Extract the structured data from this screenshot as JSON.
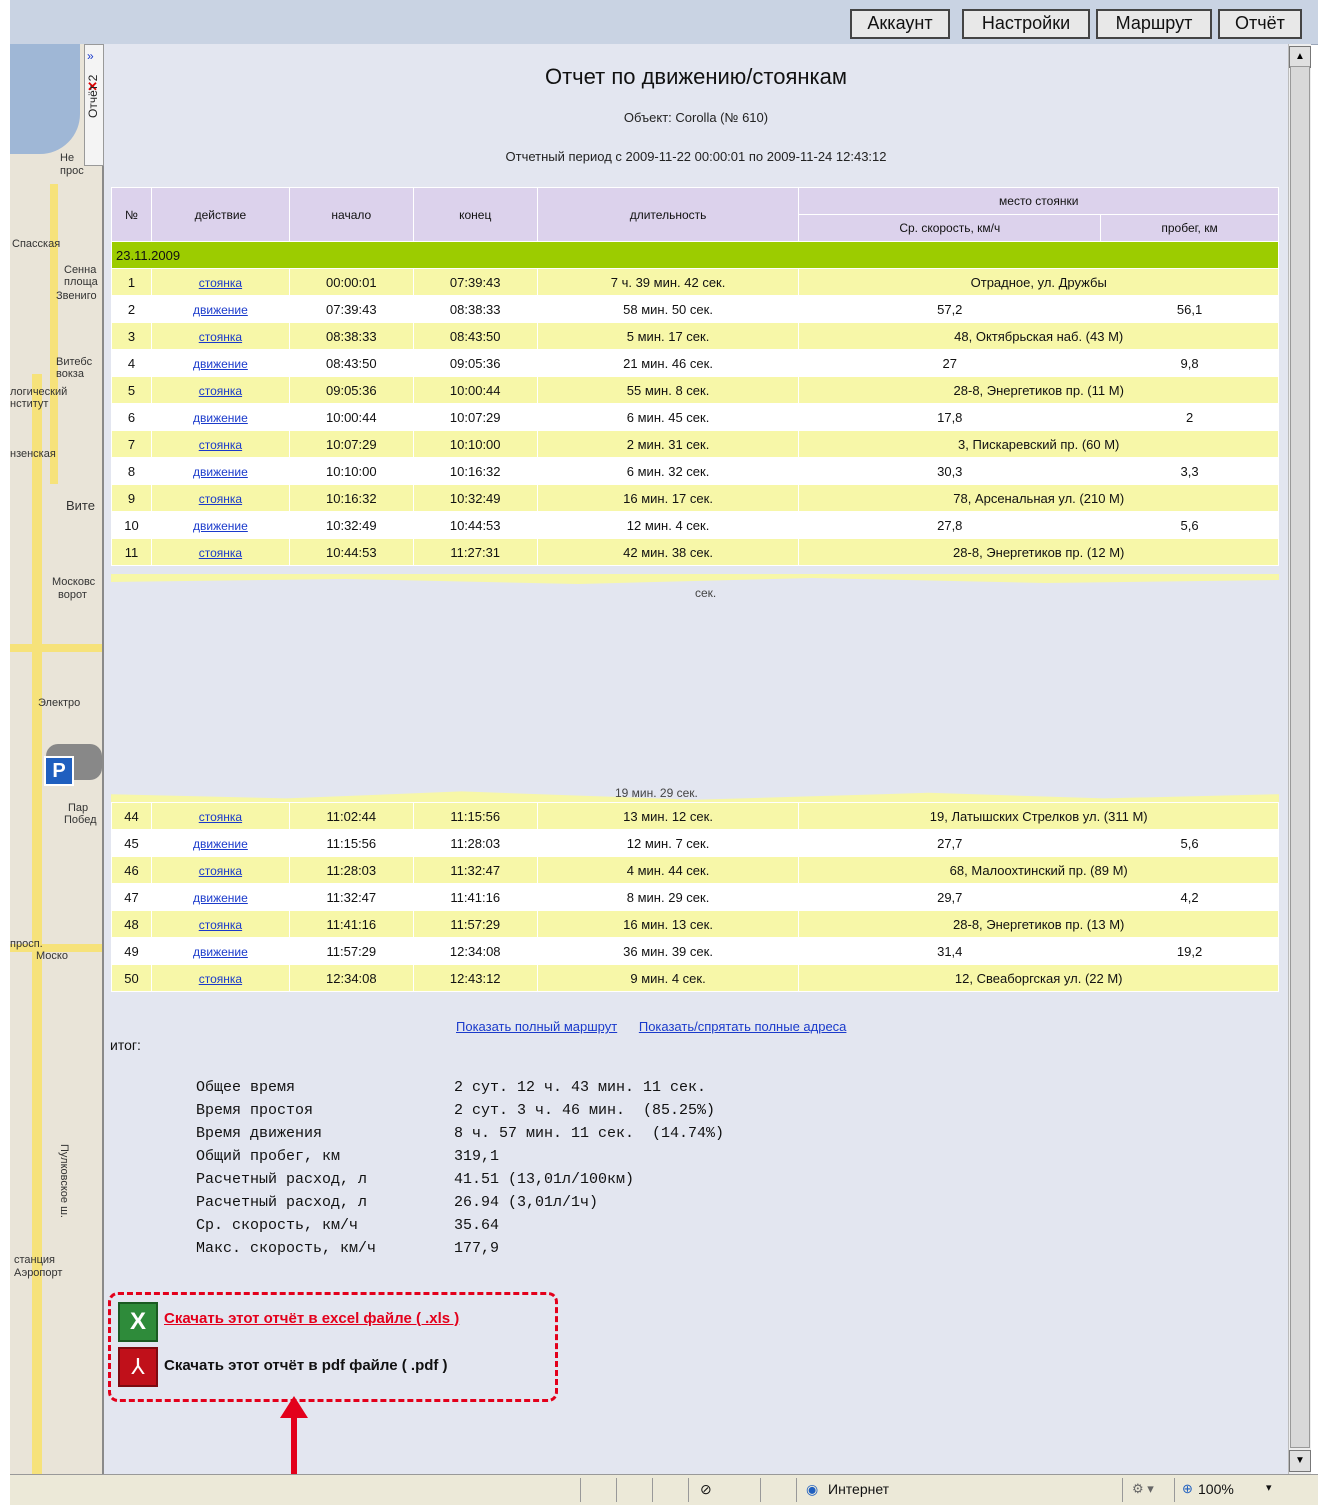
{
  "toolbar": {
    "buttons": [
      "Аккаунт",
      "Настройки",
      "Маршрут",
      "Отчёт"
    ]
  },
  "side_tab": {
    "label": "Отчёт 2",
    "close_icon": "close-x-icon",
    "collapse_icon": "double-chevron-icon"
  },
  "map": {
    "labels": [
      "Не",
      "прос",
      "Спасская",
      "Сенна",
      "площа",
      "Звениго",
      "Витебс",
      "вокза",
      "логический",
      "нститут",
      "нзенская",
      "Вите",
      "Московс",
      "ворот",
      "Электро",
      "Пар",
      "Побед",
      "просп.",
      "Моско",
      "Пулковское ш.",
      "станция",
      "Аэропорт"
    ]
  },
  "report": {
    "title": "Отчет по движению/стоянкам",
    "object_line": "Объект: Corolla (№ 610)",
    "period_line": "Отчетный период с 2009-11-22 00:00:01 по 2009-11-24 12:43:12",
    "columns": {
      "num": "№",
      "action": "действие",
      "start": "начало",
      "end": "конец",
      "duration": "длительность",
      "place_group": "место стоянки",
      "avg_speed": "Ср. скорость, км/ч",
      "mileage": "пробег, км"
    },
    "date_row": "23.11.2009",
    "rows": [
      {
        "n": "1",
        "action": "стоянка",
        "start": "00:00:01",
        "end": "07:39:43",
        "duration": "7 ч. 39 мин. 42 сек.",
        "place": "Отрадное, ул. Дружбы"
      },
      {
        "n": "2",
        "action": "движение",
        "start": "07:39:43",
        "end": "08:38:33",
        "duration": "58 мин. 50 сек.",
        "speed": "57,2",
        "mileage": "56,1"
      },
      {
        "n": "3",
        "action": "стоянка",
        "start": "08:38:33",
        "end": "08:43:50",
        "duration": "5 мин. 17 сек.",
        "place": "48, Октябрьская наб. (43 М)"
      },
      {
        "n": "4",
        "action": "движение",
        "start": "08:43:50",
        "end": "09:05:36",
        "duration": "21 мин. 46 сек.",
        "speed": "27",
        "mileage": "9,8"
      },
      {
        "n": "5",
        "action": "стоянка",
        "start": "09:05:36",
        "end": "10:00:44",
        "duration": "55 мин. 8 сек.",
        "place": "28-8, Энергетиков пр. (11 М)"
      },
      {
        "n": "6",
        "action": "движение",
        "start": "10:00:44",
        "end": "10:07:29",
        "duration": "6 мин. 45 сек.",
        "speed": "17,8",
        "mileage": "2"
      },
      {
        "n": "7",
        "action": "стоянка",
        "start": "10:07:29",
        "end": "10:10:00",
        "duration": "2 мин. 31 сек.",
        "place": "3, Пискаревский пр. (60 М)"
      },
      {
        "n": "8",
        "action": "движение",
        "start": "10:10:00",
        "end": "10:16:32",
        "duration": "6 мин. 32 сек.",
        "speed": "30,3",
        "mileage": "3,3"
      },
      {
        "n": "9",
        "action": "стоянка",
        "start": "10:16:32",
        "end": "10:32:49",
        "duration": "16 мин. 17 сек.",
        "place": "78, Арсенальная ул. (210 М)"
      },
      {
        "n": "10",
        "action": "движение",
        "start": "10:32:49",
        "end": "10:44:53",
        "duration": "12 мин. 4 сек.",
        "speed": "27,8",
        "mileage": "5,6"
      },
      {
        "n": "11",
        "action": "стоянка",
        "start": "10:44:53",
        "end": "11:27:31",
        "duration": "42 мин. 38 сек.",
        "place": "28-8, Энергетиков пр. (12 М)"
      }
    ],
    "torn_fragments": [
      "сек.",
      "19 мин. 29 сек."
    ],
    "rows_after": [
      {
        "n": "44",
        "action": "стоянка",
        "start": "11:02:44",
        "end": "11:15:56",
        "duration": "13 мин. 12 сек.",
        "place": "19, Латышских Стрелков ул. (311 М)"
      },
      {
        "n": "45",
        "action": "движение",
        "start": "11:15:56",
        "end": "11:28:03",
        "duration": "12 мин. 7 сек.",
        "speed": "27,7",
        "mileage": "5,6"
      },
      {
        "n": "46",
        "action": "стоянка",
        "start": "11:28:03",
        "end": "11:32:47",
        "duration": "4 мин. 44 сек.",
        "place": "68, Малоохтинский пр. (89 М)"
      },
      {
        "n": "47",
        "action": "движение",
        "start": "11:32:47",
        "end": "11:41:16",
        "duration": "8 мин. 29 сек.",
        "speed": "29,7",
        "mileage": "4,2"
      },
      {
        "n": "48",
        "action": "стоянка",
        "start": "11:41:16",
        "end": "11:57:29",
        "duration": "16 мин. 13 сек.",
        "place": "28-8, Энергетиков пр. (13 М)"
      },
      {
        "n": "49",
        "action": "движение",
        "start": "11:57:29",
        "end": "12:34:08",
        "duration": "36 мин. 39 сек.",
        "speed": "31,4",
        "mileage": "19,2"
      },
      {
        "n": "50",
        "action": "стоянка",
        "start": "12:34:08",
        "end": "12:43:12",
        "duration": "9 мин. 4 сек.",
        "place": "12, Свеаборгская ул. (22 М)"
      }
    ],
    "links": [
      "Показать полный маршрут",
      "Показать/спрятать полные адреса"
    ],
    "itog_label": "итог:",
    "summary": [
      {
        "k": "Общее время",
        "v": "2 сут. 12 ч. 43 мин. 11 сек."
      },
      {
        "k": "Время простоя",
        "v": "2 сут. 3 ч. 46 мин.  (85.25%)"
      },
      {
        "k": "Время движения",
        "v": "8 ч. 57 мин. 11 сек.  (14.74%)"
      },
      {
        "k": "Общий пробег, км",
        "v": "319,1"
      },
      {
        "k": "Расчетный расход, л",
        "v": "41.51 (13,01л/100км)"
      },
      {
        "k": "Расчетный расход, л",
        "v": "26.94 (3,01л/1ч)"
      },
      {
        "k": "Ср. скорость, км/ч",
        "v": "35.64"
      },
      {
        "k": "Макс. скорость, км/ч",
        "v": "177,9"
      }
    ],
    "download": {
      "xls_label": "Скачать этот отчёт в excel файле ( .xls )",
      "pdf_label": "Скачать этот отчёт в pdf файле ( .pdf )",
      "accent": "#e3001b"
    }
  },
  "statusbar": {
    "zone": "Интернет",
    "zoom": "100%"
  }
}
